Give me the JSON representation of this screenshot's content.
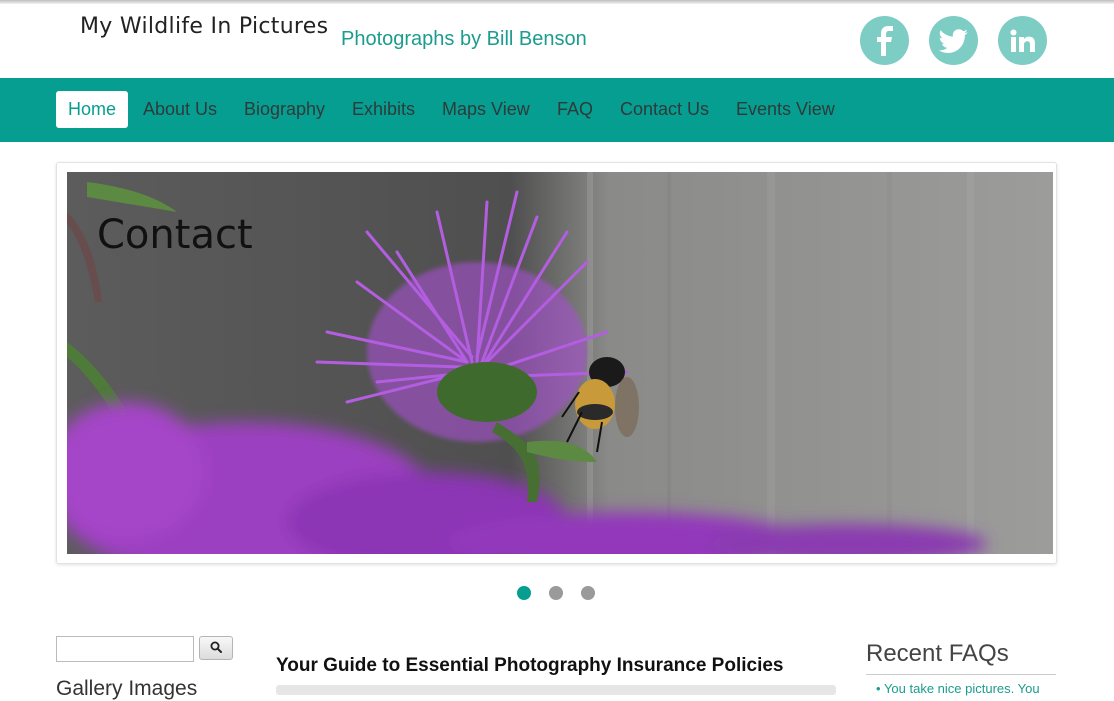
{
  "header": {
    "site_title": "My Wildlife In Pictures",
    "tagline": "Photographs by Bill Benson",
    "social": [
      {
        "icon": "facebook-icon"
      },
      {
        "icon": "twitter-icon"
      },
      {
        "icon": "linkedin-icon"
      }
    ]
  },
  "nav": {
    "items": [
      {
        "label": "Home",
        "active": true
      },
      {
        "label": "About Us"
      },
      {
        "label": "Biography"
      },
      {
        "label": "Exhibits"
      },
      {
        "label": "Maps View"
      },
      {
        "label": "FAQ"
      },
      {
        "label": "Contact Us"
      },
      {
        "label": "Events View"
      }
    ]
  },
  "slider": {
    "caption": "Contact",
    "active_slide": 1,
    "slide_count": 3
  },
  "sidebar": {
    "search_value": "",
    "search_icon": "magnifier-icon",
    "gallery_heading": "Gallery Images"
  },
  "main": {
    "article_title": "Your Guide to Essential Photography Insurance Policies"
  },
  "faq": {
    "heading": "Recent FAQs",
    "items": [
      "You take nice pictures. You"
    ]
  },
  "colors": {
    "accent": "#069e90",
    "social_bg": "#7ecdc5",
    "tagline": "#1b9c8e"
  }
}
